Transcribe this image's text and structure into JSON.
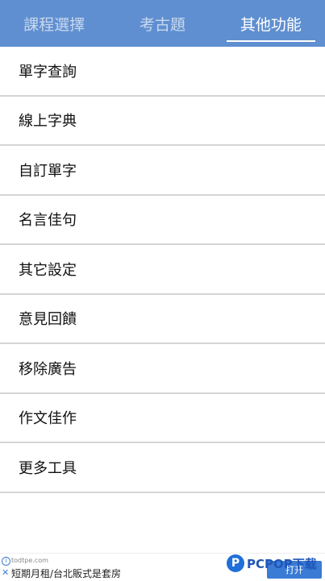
{
  "tabs": [
    {
      "label": "課程選擇",
      "active": false
    },
    {
      "label": "考古題",
      "active": false
    },
    {
      "label": "其他功能",
      "active": true
    }
  ],
  "menu": [
    {
      "label": "單字查詢"
    },
    {
      "label": "線上字典"
    },
    {
      "label": "自訂單字"
    },
    {
      "label": "名言佳句"
    },
    {
      "label": "其它設定"
    },
    {
      "label": "意見回饋"
    },
    {
      "label": "移除廣告"
    },
    {
      "label": "作文佳作"
    },
    {
      "label": "更多工具"
    }
  ],
  "ad": {
    "info_icon": "i",
    "close_icon": "✕",
    "domain": "todtpe.com",
    "title": "短期月租/台北販式是套房",
    "open_label": "打开"
  },
  "watermark": {
    "logo_letter": "P",
    "text": "PCPOP下载"
  },
  "colors": {
    "tabbar": "#5f8fd0",
    "tab_inactive": "#c9d8ef",
    "tab_active": "#ffffff",
    "divider": "#d5d5d5",
    "ad_button": "#3a7bd5"
  }
}
